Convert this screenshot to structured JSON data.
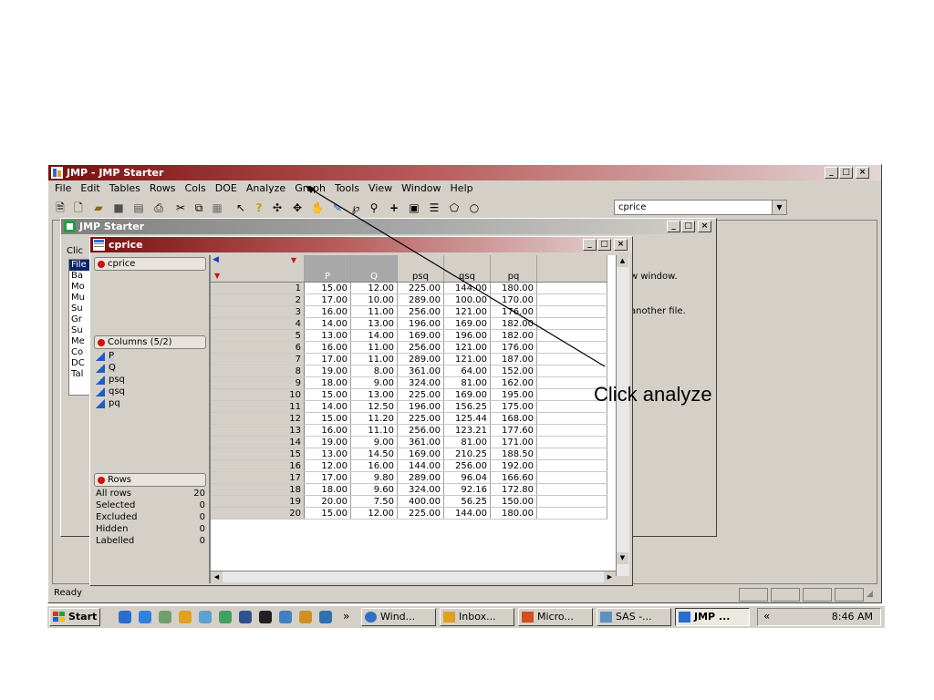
{
  "app": {
    "title": "JMP - JMP Starter"
  },
  "menubar": [
    "File",
    "Edit",
    "Tables",
    "Rows",
    "Cols",
    "DOE",
    "Analyze",
    "Graph",
    "Tools",
    "View",
    "Window",
    "Help"
  ],
  "toolbar": {
    "combo_value": "cprice"
  },
  "starter": {
    "title": "JMP Starter",
    "click_label": "Clic",
    "list": [
      "File",
      "Ba",
      "Mo",
      "Mu",
      "Su",
      "Gr",
      "Su",
      "Me",
      "Co",
      "DC",
      "Tal"
    ],
    "text1": "w window.",
    "text2": "another file."
  },
  "cprice": {
    "title": "cprice",
    "table_panel_label": "cprice",
    "columns_panel_label": "Columns (5/2)",
    "columns": [
      "P",
      "Q",
      "psq",
      "qsq",
      "pq"
    ],
    "rows_panel_label": "Rows",
    "rows_info": [
      {
        "label": "All rows",
        "value": "20"
      },
      {
        "label": "Selected",
        "value": "0"
      },
      {
        "label": "Excluded",
        "value": "0"
      },
      {
        "label": "Hidden",
        "value": "0"
      },
      {
        "label": "Labelled",
        "value": "0"
      }
    ],
    "headers": [
      "P",
      "Q",
      "psq",
      "qsq",
      "pq"
    ],
    "rows": [
      [
        "1",
        "15.00",
        "12.00",
        "225.00",
        "144.00",
        "180.00"
      ],
      [
        "2",
        "17.00",
        "10.00",
        "289.00",
        "100.00",
        "170.00"
      ],
      [
        "3",
        "16.00",
        "11.00",
        "256.00",
        "121.00",
        "176.00"
      ],
      [
        "4",
        "14.00",
        "13.00",
        "196.00",
        "169.00",
        "182.00"
      ],
      [
        "5",
        "13.00",
        "14.00",
        "169.00",
        "196.00",
        "182.00"
      ],
      [
        "6",
        "16.00",
        "11.00",
        "256.00",
        "121.00",
        "176.00"
      ],
      [
        "7",
        "17.00",
        "11.00",
        "289.00",
        "121.00",
        "187.00"
      ],
      [
        "8",
        "19.00",
        "8.00",
        "361.00",
        "64.00",
        "152.00"
      ],
      [
        "9",
        "18.00",
        "9.00",
        "324.00",
        "81.00",
        "162.00"
      ],
      [
        "10",
        "15.00",
        "13.00",
        "225.00",
        "169.00",
        "195.00"
      ],
      [
        "11",
        "14.00",
        "12.50",
        "196.00",
        "156.25",
        "175.00"
      ],
      [
        "12",
        "15.00",
        "11.20",
        "225.00",
        "125.44",
        "168.00"
      ],
      [
        "13",
        "16.00",
        "11.10",
        "256.00",
        "123.21",
        "177.60"
      ],
      [
        "14",
        "19.00",
        "9.00",
        "361.00",
        "81.00",
        "171.00"
      ],
      [
        "15",
        "13.00",
        "14.50",
        "169.00",
        "210.25",
        "188.50"
      ],
      [
        "16",
        "12.00",
        "16.00",
        "144.00",
        "256.00",
        "192.00"
      ],
      [
        "17",
        "17.00",
        "9.80",
        "289.00",
        "96.04",
        "166.60"
      ],
      [
        "18",
        "18.00",
        "9.60",
        "324.00",
        "92.16",
        "172.80"
      ],
      [
        "19",
        "20.00",
        "7.50",
        "400.00",
        "56.25",
        "150.00"
      ],
      [
        "20",
        "15.00",
        "12.00",
        "225.00",
        "144.00",
        "180.00"
      ]
    ]
  },
  "annotation": {
    "text": "Click analyze"
  },
  "statusbar": {
    "text": "Ready"
  },
  "taskbar": {
    "start_label": "Start",
    "more_glyph": "»",
    "buttons": [
      "Wind...",
      "Inbox...",
      "Micro...",
      "SAS -...",
      "JMP ..."
    ],
    "tray_glyph": "«",
    "clock": "8:46 AM"
  },
  "colors": {
    "title_active": "#7a1010",
    "desktop": "#ffffff",
    "chrome": "#d4d0c8",
    "taskbar": "#d4d0c8"
  }
}
